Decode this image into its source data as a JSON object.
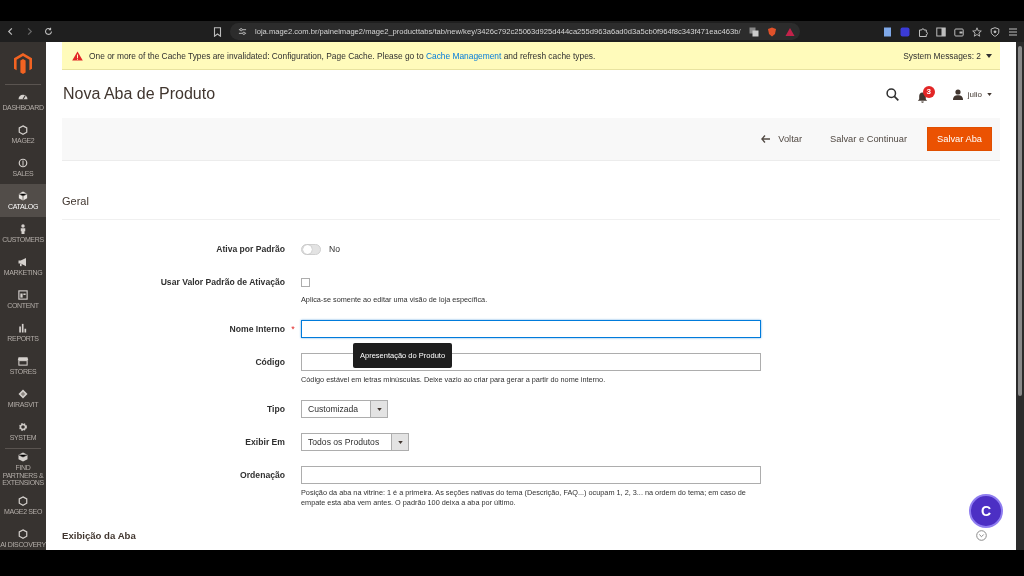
{
  "browser": {
    "url": "loja.mage2.com.br/painelmage2/mage2_producttabs/tab/new/key/3426c792c25063d925d444ca255d963a6ad0d3a5cb0f964f8c343f471eac463b/"
  },
  "sidebar": {
    "items": [
      {
        "label": "DASHBOARD",
        "selected": false
      },
      {
        "label": "MAGE2",
        "selected": false
      },
      {
        "label": "SALES",
        "selected": false
      },
      {
        "label": "CATALOG",
        "selected": true
      },
      {
        "label": "CUSTOMERS",
        "selected": false
      },
      {
        "label": "MARKETING",
        "selected": false
      },
      {
        "label": "CONTENT",
        "selected": false
      },
      {
        "label": "REPORTS",
        "selected": false
      },
      {
        "label": "STORES",
        "selected": false
      },
      {
        "label": "MIRASVIT",
        "selected": false
      },
      {
        "label": "SYSTEM",
        "selected": false
      },
      {
        "label": "FIND PARTNERS & EXTENSIONS",
        "selected": false
      },
      {
        "label": "MAGE2 SEO",
        "selected": false
      },
      {
        "label": "AI DISCOVERY",
        "selected": false
      }
    ]
  },
  "notice": {
    "text_before": "One or more of the Cache Types are invalidated: Configuration, Page Cache. Please go to",
    "link": "Cache Management",
    "text_after": "and refresh cache types.",
    "system_messages": "System Messages: 2"
  },
  "header": {
    "title": "Nova Aba de Produto",
    "notification_count": "3",
    "user": "julio"
  },
  "actions": [
    {
      "label": "Voltar",
      "kind": "back"
    },
    {
      "label": "Salvar e Continuar",
      "kind": "secondary"
    },
    {
      "label": "Salvar Aba",
      "kind": "primary"
    }
  ],
  "section": {
    "title": "Geral"
  },
  "fields": [
    {
      "kind": "toggle",
      "label": "Ativa por Padrão",
      "on": false,
      "value_text": "No"
    },
    {
      "kind": "checkbox",
      "label": "Usar Valor Padrão de Ativação",
      "checked": false,
      "note": "Aplica-se somente ao editar uma visão de loja específica."
    },
    {
      "kind": "text",
      "label": "Nome Interno",
      "required_mark": "*",
      "focused": true,
      "tooltip": "Apresentação do Produto"
    },
    {
      "kind": "text",
      "label": "Código",
      "focused": false,
      "note": "Código estável em letras minúsculas. Deixe vazio ao criar para gerar a partir do nome interno."
    },
    {
      "kind": "select",
      "label": "Tipo",
      "value": "Customizada"
    },
    {
      "kind": "select",
      "label": "Exibir Em",
      "value": "Todos os Produtos"
    },
    {
      "kind": "text",
      "label": "Ordenação",
      "focused": false,
      "note": "Posição da aba na vitrine: 1 é a primeira. As seções nativas do tema (Descrição, FAQ...) ocupam 1, 2, 3... na ordem do tema; em caso de empate esta aba vem antes. O padrão 100 deixa a aba por último."
    }
  ],
  "next_section": {
    "title": "Exibição da Aba"
  },
  "chat_button": {
    "label": "C"
  }
}
